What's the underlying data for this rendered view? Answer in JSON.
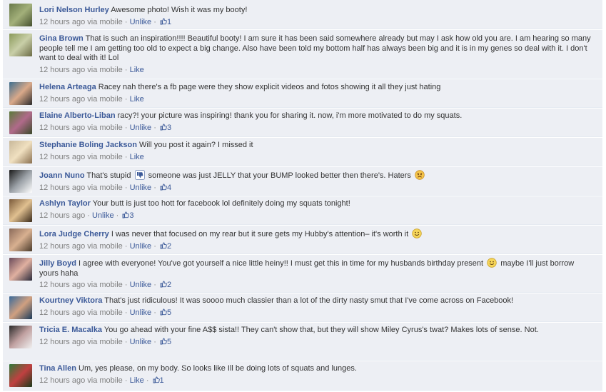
{
  "colors": {
    "row_background": "#edeff4",
    "link": "#3b5998",
    "meta": "#808080",
    "text": "#333333"
  },
  "comments": [
    {
      "author": "Lori Nelson Hurley",
      "text": "Awesome photo! Wish it was my booty!",
      "time": "12 hours ago via mobile",
      "action": "Unlike",
      "likes": "1",
      "avatar_colors": [
        "#6a7a4a",
        "#a3b07a",
        "#45502f"
      ]
    },
    {
      "author": "Gina Brown",
      "text": "That is such an inspiration!!!! Beautiful booty! I am sure it has been said somewhere already but may I ask how old you are. I am hearing so many people tell me I am getting too old to expect a big change. Also have been told my bottom half has always been big and it is in my genes so deal with it. I don't want to deal with it! Lol",
      "time": "12 hours ago via mobile",
      "action": "Like",
      "likes": "",
      "avatar_colors": [
        "#8a9a5a",
        "#c9cfa8",
        "#6b6b45"
      ]
    },
    {
      "author": "Helena Arteaga",
      "text": "Racey nah there's a fb page were they show explicit videos and fotos showing it all they just hating",
      "time": "12 hours ago via mobile",
      "action": "Like",
      "likes": "",
      "avatar_colors": [
        "#3f6f8f",
        "#d9a98a",
        "#2b2b2b"
      ]
    },
    {
      "author": "Elaine Alberto-Liban",
      "text": "racy?! your picture was inspiring! thank you for sharing it. now, i'm more motivated to do my squats.",
      "time": "12 hours ago via mobile",
      "action": "Unlike",
      "likes": "3",
      "avatar_colors": [
        "#5a7a3a",
        "#b06a8a",
        "#3a4a2a"
      ]
    },
    {
      "author": "Stephanie Boling Jackson",
      "text": "Will you post it again? I missed it",
      "time": "12 hours ago via mobile",
      "action": "Like",
      "likes": "",
      "avatar_colors": [
        "#c8b89a",
        "#f0e0c0",
        "#8a7050"
      ]
    },
    {
      "author": "Joann Nuno",
      "text_before": "That's stupid",
      "text_after": "someone was just JELLY that your BUMP looked better then there's. Haters",
      "time": "12 hours ago via mobile",
      "action": "Unlike",
      "likes": "4",
      "avatar_colors": [
        "#1a1a1a",
        "#9aa0a6",
        "#ffffff"
      ]
    },
    {
      "author": "Ashlyn Taylor",
      "text": "Your butt is just too hott for facebook lol definitely doing my squats tonight!",
      "time": "12 hours ago",
      "action": "Unlike",
      "likes": "3",
      "avatar_colors": [
        "#7a5a3a",
        "#e0c090",
        "#3a2a1a"
      ]
    },
    {
      "author": "Lora Judge Cherry",
      "text": "I was never that focused on my rear but it sure gets my Hubby's attention– it's worth it",
      "time": "12 hours ago via mobile",
      "action": "Unlike",
      "likes": "2",
      "avatar_colors": [
        "#8a6a5a",
        "#d8b090",
        "#4a3a2a"
      ]
    },
    {
      "author": "Jilly Boyd",
      "text_before": "I agree with everyone! You've got yourself a nice little heiny!! I must get this in time for my husbands birthday present",
      "text_after": "maybe I'll just borrow yours haha",
      "time": "12 hours ago via mobile",
      "action": "Unlike",
      "likes": "2",
      "avatar_colors": [
        "#6a4a5a",
        "#e0b0a0",
        "#2a2a3a"
      ]
    },
    {
      "author": "Kourtney Viktora",
      "text": "That's just ridiculous! It was soooo much classier than a lot of the dirty nasty smut that I've come across on Facebook!",
      "time": "12 hours ago via mobile",
      "action": "Unlike",
      "likes": "5",
      "avatar_colors": [
        "#3a6a9a",
        "#d0a080",
        "#1a3a5a"
      ]
    },
    {
      "author": "Tricia E. Macalka",
      "text": "You go ahead with your fine A$$ sista!! They can't show that, but they will show Miley Cyrus's twat? Makes lots of sense. Not.",
      "time": "12 hours ago via mobile",
      "action": "Unlike",
      "likes": "5",
      "avatar_colors": [
        "#2a2a2a",
        "#c0a0a0",
        "#f0f0f0"
      ]
    },
    {
      "author": "Tina Allen",
      "text": "Um, yes please, on my body. So looks like Ill be doing lots of squats and lunges.",
      "time": "12 hours ago via mobile",
      "action": "Like",
      "likes": "1",
      "avatar_colors": [
        "#2f7a3a",
        "#c04040",
        "#1a3a1a"
      ]
    }
  ]
}
